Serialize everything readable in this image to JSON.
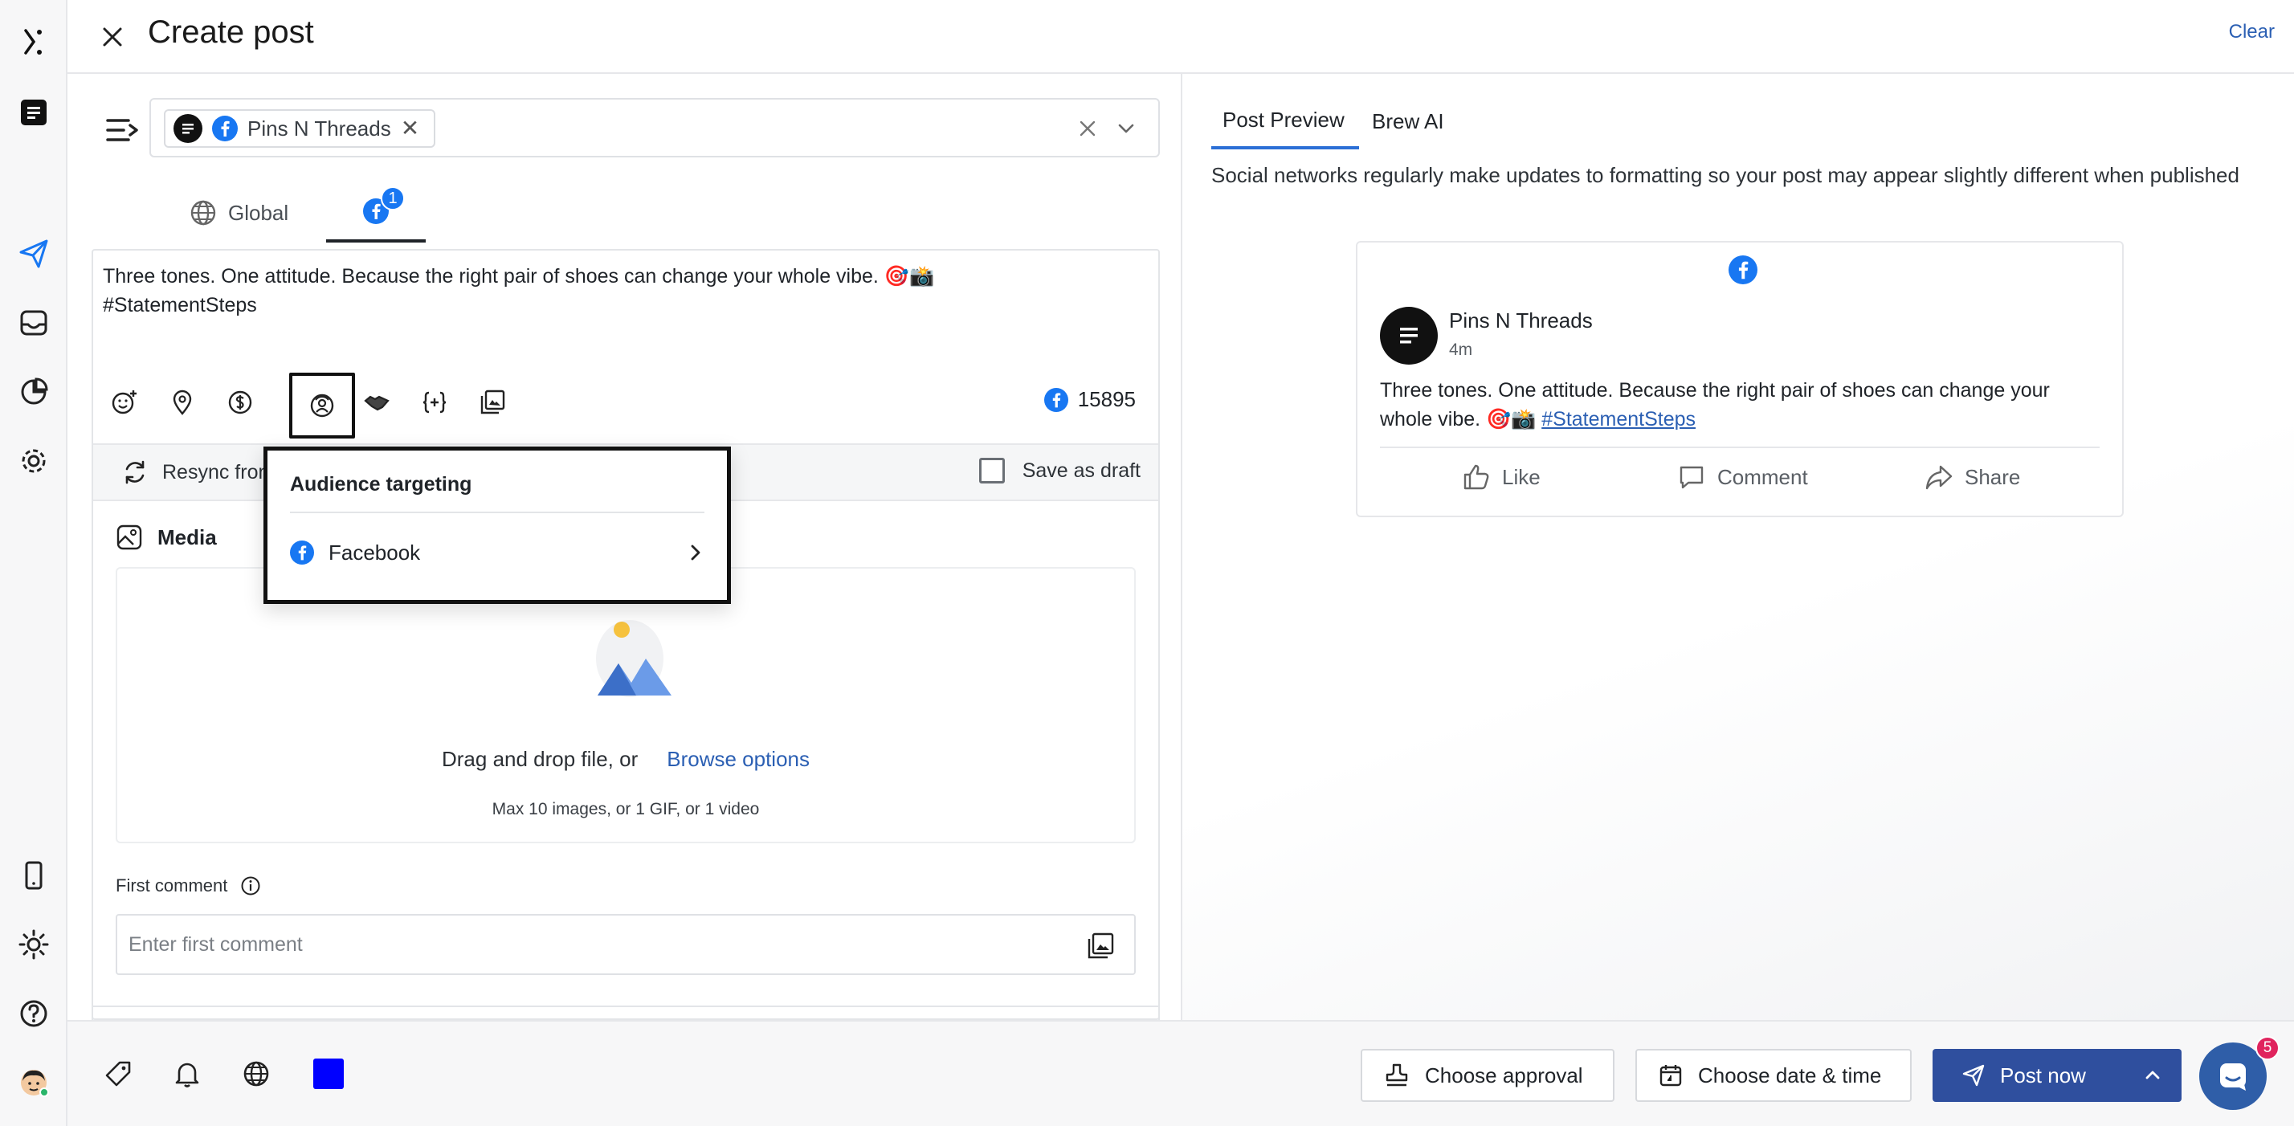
{
  "header": {
    "title": "Create post",
    "clear_label": "Clear"
  },
  "accounts": {
    "selected_chip_label": "Pins N Threads"
  },
  "tabs": {
    "global_label": "Global",
    "facebook_badge": "1"
  },
  "compose": {
    "line1": "Three tones. One attitude. Because the right pair of shoes can change your whole vibe. 🎯📸",
    "line2": "#StatementSteps",
    "char_count": "15895"
  },
  "resync": {
    "label": "Resync from",
    "save_as_draft_label": "Save as draft"
  },
  "media": {
    "title": "Media",
    "drop_text": "Drag and drop file, or",
    "browse_link": "Browse options",
    "hint": "Max 10 images, or 1 GIF, or 1 video"
  },
  "first_comment": {
    "label": "First comment",
    "placeholder": "Enter first comment"
  },
  "popover": {
    "title": "Audience targeting",
    "item_label": "Facebook"
  },
  "preview": {
    "tab_preview": "Post Preview",
    "tab_ai": "Brew AI",
    "note": "Social networks regularly make updates to formatting so your post may appear slightly different when published",
    "card": {
      "name": "Pins N Threads",
      "time": "4m",
      "text": "Three tones. One attitude. Because the right pair of shoes can change your whole vibe. 🎯📸",
      "hashtag": "#StatementSteps",
      "like": "Like",
      "comment": "Comment",
      "share": "Share"
    }
  },
  "bottom": {
    "approval_label": "Choose approval",
    "date_label": "Choose date & time",
    "post_label": "Post now",
    "chat_badge": "5",
    "swatch_color": "#0000ff"
  },
  "colors": {
    "facebook_blue": "#1877f2",
    "primary_button": "#2f4f9e",
    "link": "#2b5fb3"
  }
}
